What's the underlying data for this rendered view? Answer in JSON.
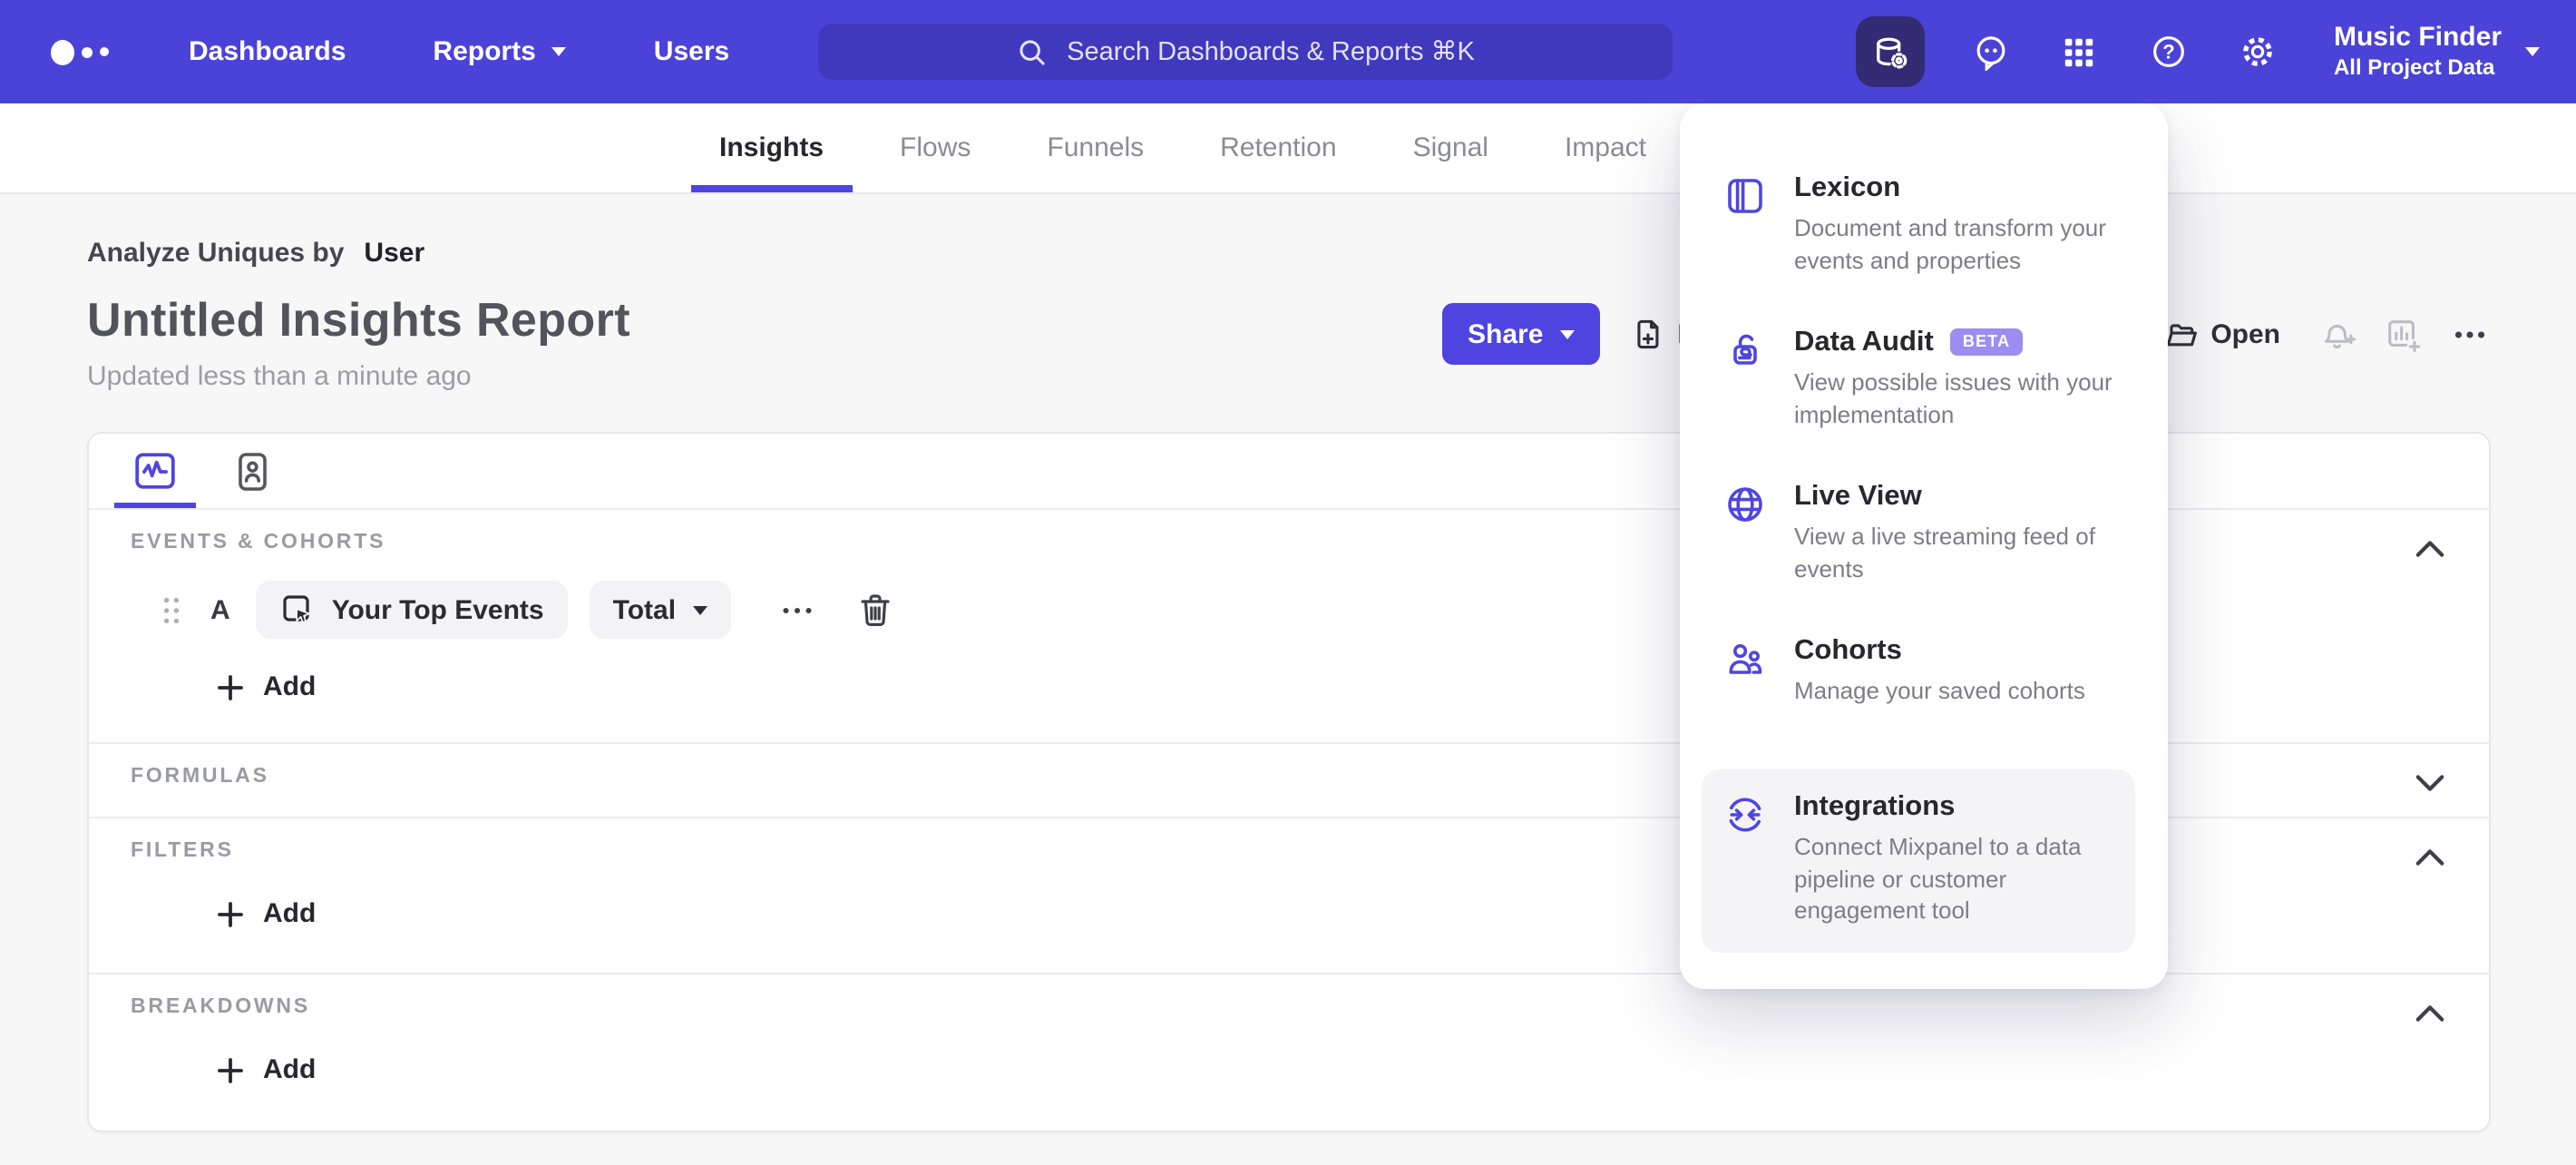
{
  "colors": {
    "nav_purple": "#4b43d8",
    "accent": "#4f44e0",
    "active_tile": "#332c75",
    "page_bg": "#f7f7f8",
    "beta_badge": "#9b8df1"
  },
  "nav": {
    "logo_icon": "mixpanel-dots-logo",
    "items": [
      {
        "label": "Dashboards"
      },
      {
        "label": "Reports"
      },
      {
        "label": "Users"
      }
    ],
    "search": {
      "icon": "search-icon",
      "placeholder": "Search Dashboards & Reports ⌘K"
    },
    "right_icons": [
      "data-management-icon",
      "feedback-chat-icon",
      "apps-grid-icon",
      "help-icon",
      "settings-gear-icon"
    ],
    "project": {
      "name": "Music Finder",
      "scope": "All Project Data"
    }
  },
  "tabs": {
    "items": [
      {
        "label": "Insights",
        "active": true
      },
      {
        "label": "Flows",
        "active": false
      },
      {
        "label": "Funnels",
        "active": false
      },
      {
        "label": "Retention",
        "active": false
      },
      {
        "label": "Signal",
        "active": false
      },
      {
        "label": "Impact",
        "active": false
      }
    ]
  },
  "header": {
    "analyze_label": "Analyze Uniques by",
    "analyze_value": "User",
    "title": "Untitled Insights Report",
    "updated": "Updated less than a minute ago",
    "share_label": "Share",
    "new_report_label": "New Report",
    "open_label": "Open",
    "toolbar_icons": [
      "new-report-icon",
      "open-folder-icon",
      "alert-bell-plus-icon",
      "add-to-dashboard-icon",
      "more-ellipsis-icon"
    ]
  },
  "menu": {
    "items": [
      {
        "icon": "lexicon-book-icon",
        "title": "Lexicon",
        "description": "Document and transform your events and properties"
      },
      {
        "icon": "data-audit-lock-icon",
        "title": "Data Audit",
        "badge": "BETA",
        "description": "View possible issues with your implementation"
      },
      {
        "icon": "live-view-globe-icon",
        "title": "Live View",
        "description": "View a live streaming feed of events"
      },
      {
        "icon": "cohorts-people-icon",
        "title": "Cohorts",
        "description": "Manage your saved cohorts"
      },
      {
        "icon": "integrations-sync-icon",
        "title": "Integrations",
        "description": "Connect Mixpanel to a data pipeline or customer engagement tool",
        "highlighted": true
      }
    ]
  },
  "builder": {
    "view_icons": [
      "insights-chart-tab-icon",
      "profiles-person-tab-icon"
    ],
    "sections": {
      "events": {
        "label": "EVENTS & COHORTS",
        "chevron": "up",
        "row": {
          "letter": "A",
          "event": "Your Top Events",
          "metric": "Total"
        },
        "add_label": "Add"
      },
      "formulas": {
        "label": "FORMULAS",
        "chevron": "down"
      },
      "filters": {
        "label": "FILTERS",
        "chevron": "up",
        "add_label": "Add"
      },
      "breakdowns": {
        "label": "BREAKDOWNS",
        "chevron": "up",
        "add_label": "Add"
      }
    }
  }
}
